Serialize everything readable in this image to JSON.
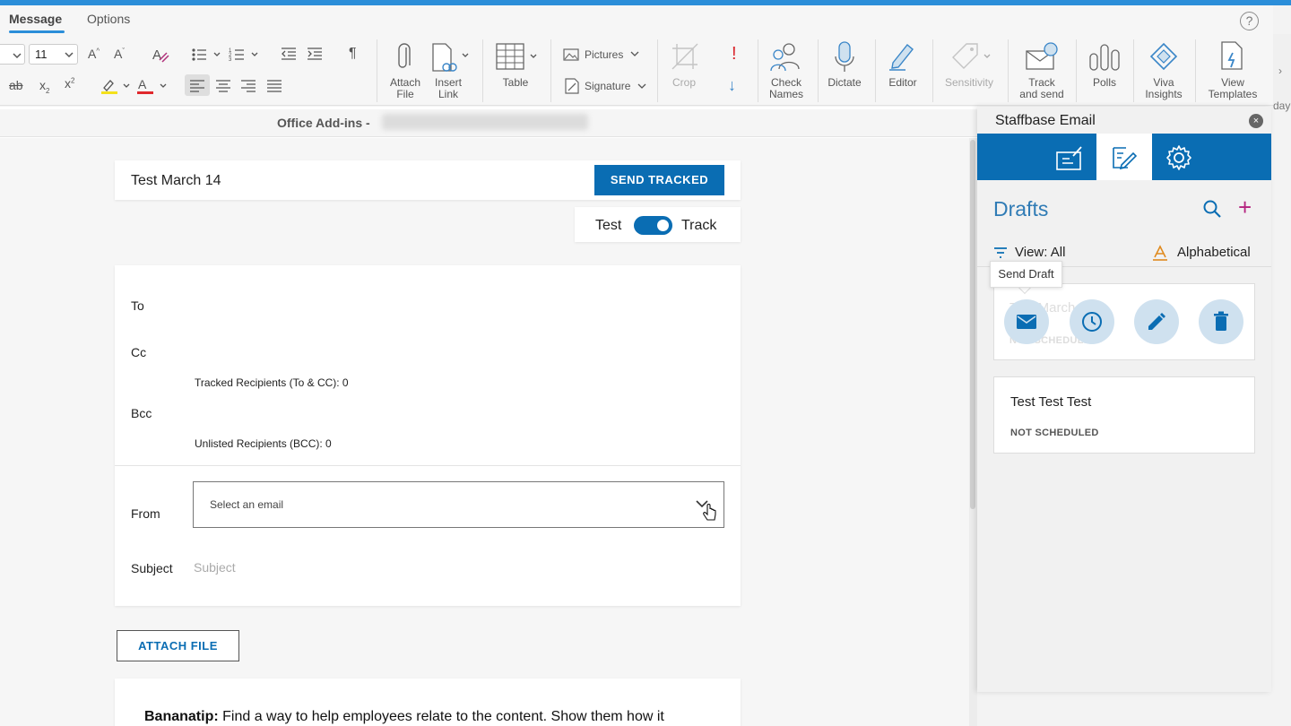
{
  "tabs": {
    "message": "Message",
    "options": "Options"
  },
  "help_glyph": "?",
  "ribbon": {
    "font_size": "11",
    "attach_file": [
      "Attach",
      "File"
    ],
    "insert_link": [
      "Insert",
      "Link"
    ],
    "table": "Table",
    "pictures": "Pictures",
    "signature": "Signature",
    "crop": "Crop",
    "check_names": [
      "Check",
      "Names"
    ],
    "dictate": "Dictate",
    "editor": "Editor",
    "sensitivity": "Sensitivity",
    "track_and_send": [
      "Track",
      "and send"
    ],
    "polls": "Polls",
    "viva_insights": [
      "Viva",
      "Insights"
    ],
    "view_templates": [
      "View",
      "Templates"
    ],
    "paragraph_glyph": "¶",
    "importance_glyph": "!",
    "low_importance_glyph": "↓",
    "overflow_glyph": "›"
  },
  "right_edge_text": "day",
  "addin": {
    "title": "Office Add-ins -"
  },
  "compose": {
    "subject_title": "Test March 14",
    "send_tracked_label": "SEND TRACKED",
    "toggle_left": "Test",
    "toggle_right": "Track",
    "toggle_on": true,
    "to_label": "To",
    "cc_label": "Cc",
    "tracked_recipients": "Tracked Recipients (To & CC): 0",
    "bcc_label": "Bcc",
    "unlisted_recipients": "Unlisted Recipients (BCC): 0",
    "from_label": "From",
    "from_placeholder": "Select an email",
    "subject_label": "Subject",
    "subject_placeholder": "Subject",
    "attach_file_label": "ATTACH FILE",
    "tip_bold": "Bananatip:",
    "tip_text": " Find a way to help employees relate to the content. Show them how it"
  },
  "panel": {
    "title": "Staffbase Email",
    "close_glyph": "×",
    "drafts_heading": "Drafts",
    "add_glyph": "+",
    "view_label": "View: All",
    "sort_label": "Alphabetical",
    "tooltip": "Send Draft",
    "drafts": [
      {
        "title": "Test March 14",
        "status": "NOT SCHEDULED"
      },
      {
        "title": "Test Test Test",
        "status": "NOT SCHEDULED"
      }
    ]
  },
  "colors": {
    "accent": "#0a6db3",
    "topbar": "#2b8ed9",
    "drafts_heading": "#2f7bb5",
    "sort_icon": "#e08a1e",
    "add_icon": "#b4237f"
  }
}
